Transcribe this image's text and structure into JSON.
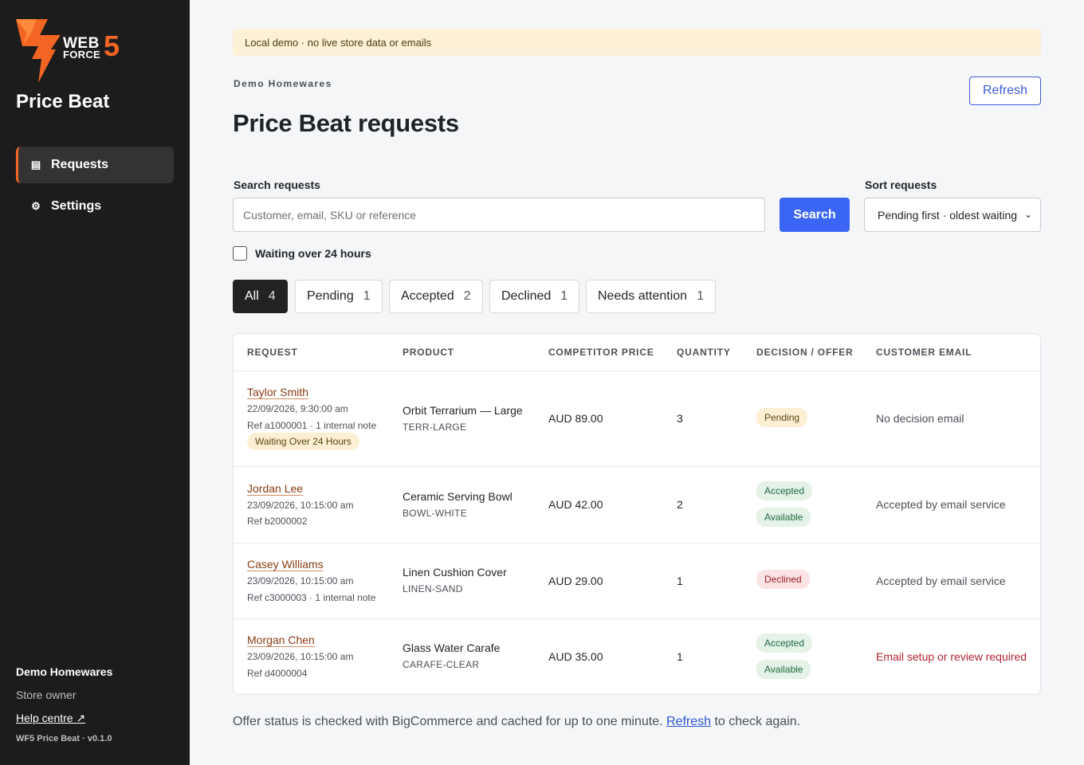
{
  "brand": {
    "logo_web": "WEB",
    "logo_force": "FORCE",
    "logo_five": "5",
    "accent": "#f26522"
  },
  "sidebar": {
    "app_title": "Price Beat",
    "items": [
      {
        "label": "Requests",
        "icon": "list-icon"
      },
      {
        "label": "Settings",
        "icon": "gear-icon"
      }
    ],
    "store_name": "Demo Homewares",
    "role": "Store owner",
    "help_link": "Help centre ↗",
    "version": "WF5 Price Beat · v0.1.0"
  },
  "banner": "Local demo · no live store data or emails",
  "header": {
    "store_label": "Demo Homewares",
    "title": "Price Beat requests",
    "refresh_label": "Refresh"
  },
  "filters": {
    "search_label": "Search requests",
    "search_placeholder": "Customer, email, SKU or reference",
    "search_button": "Search",
    "sort_label": "Sort requests",
    "sort_value": "Pending first · oldest waiting",
    "waiting_checkbox": "Waiting over 24 hours"
  },
  "tabs": [
    {
      "label": "All",
      "count": "4"
    },
    {
      "label": "Pending",
      "count": "1"
    },
    {
      "label": "Accepted",
      "count": "2"
    },
    {
      "label": "Declined",
      "count": "1"
    },
    {
      "label": "Needs attention",
      "count": "1"
    }
  ],
  "table": {
    "columns": [
      "REQUEST",
      "PRODUCT",
      "COMPETITOR PRICE",
      "QUANTITY",
      "DECISION / OFFER",
      "CUSTOMER EMAIL"
    ],
    "rows": [
      {
        "name": "Taylor Smith",
        "date": "22/09/2026, 9:30:00 am",
        "ref": "Ref a1000001 · 1 internal note",
        "flag": "Waiting Over 24 Hours",
        "product": "Orbit Terrarium — Large",
        "sku": "TERR-LARGE",
        "price": "AUD 89.00",
        "qty": "3",
        "decision": "Pending",
        "offer": "",
        "email": "No decision email"
      },
      {
        "name": "Jordan Lee",
        "date": "23/09/2026, 10:15:00 am",
        "ref": "Ref b2000002",
        "flag": "",
        "product": "Ceramic Serving Bowl",
        "sku": "BOWL-WHITE",
        "price": "AUD 42.00",
        "qty": "2",
        "decision": "Accepted",
        "offer": "Available",
        "email": "Accepted by email service"
      },
      {
        "name": "Casey Williams",
        "date": "23/09/2026, 10:15:00 am",
        "ref": "Ref c3000003 · 1 internal note",
        "flag": "",
        "product": "Linen Cushion Cover",
        "sku": "LINEN-SAND",
        "price": "AUD 29.00",
        "qty": "1",
        "decision": "Declined",
        "offer": "",
        "email": "Accepted by email service"
      },
      {
        "name": "Morgan Chen",
        "date": "23/09/2026, 10:15:00 am",
        "ref": "Ref d4000004",
        "flag": "",
        "product": "Glass Water Carafe",
        "sku": "CARAFE-CLEAR",
        "price": "AUD 35.00",
        "qty": "1",
        "decision": "Accepted",
        "offer": "Available",
        "email": "Email setup or review required"
      }
    ]
  },
  "footnote": {
    "before": "Offer status is checked with BigCommerce and cached for up to one minute.",
    "link": "Refresh",
    "after": "to check again."
  }
}
